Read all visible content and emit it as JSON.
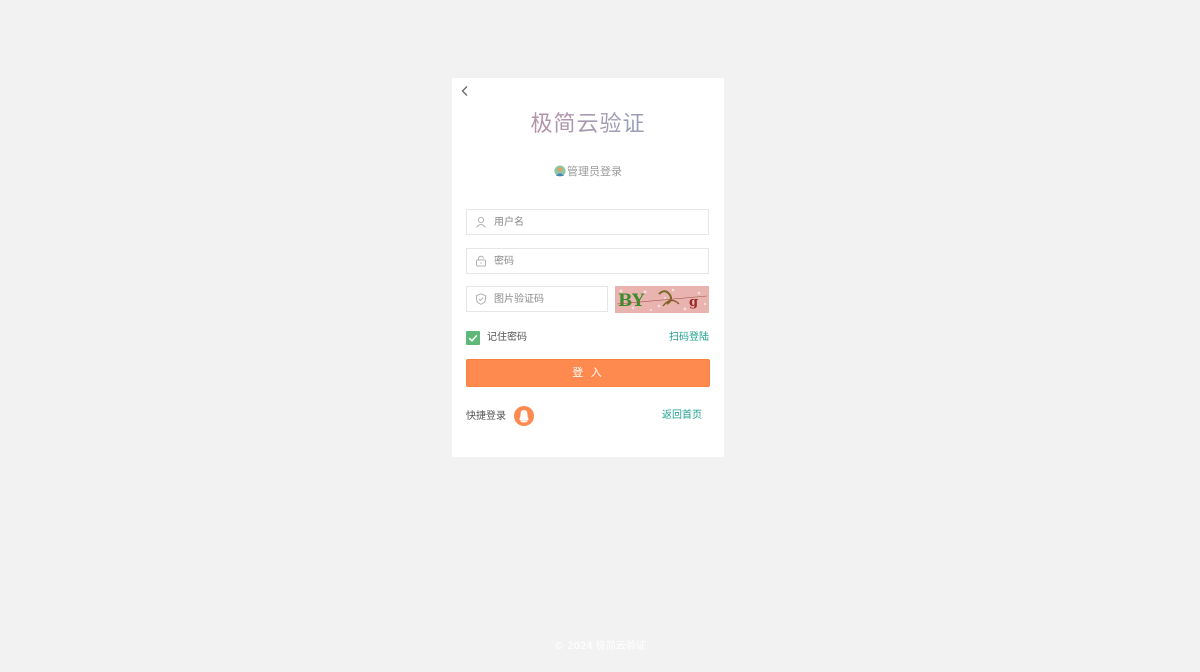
{
  "login": {
    "title": "极简云验证",
    "subtitle": "管理员登录",
    "username_placeholder": "用户名",
    "password_placeholder": "密码",
    "captcha_placeholder": "图片验证码",
    "captcha_text": "BY",
    "captcha_tail": "g",
    "remember_label": "记住密码",
    "remember_checked": true,
    "qr_login_label": "扫码登陆",
    "submit_label": "登 入",
    "quick_login_label": "快捷登录",
    "home_link_label": "返回首页"
  },
  "footer": {
    "copyright": "© 2024  极简云验证"
  },
  "icons": {
    "back": "chevron-left-icon",
    "admin": "admin-avatar-icon",
    "username": "user-icon",
    "password": "lock-icon",
    "captcha": "shield-icon",
    "checkbox": "check-icon",
    "quick_login": "qq-penguin-icon"
  },
  "colors": {
    "background": "#f2f2f2",
    "card": "#ffffff",
    "primary_button": "#ff8a4f",
    "link": "#1e9f8e",
    "checkbox": "#5fb878",
    "captcha_background": "#e9b3b0"
  }
}
